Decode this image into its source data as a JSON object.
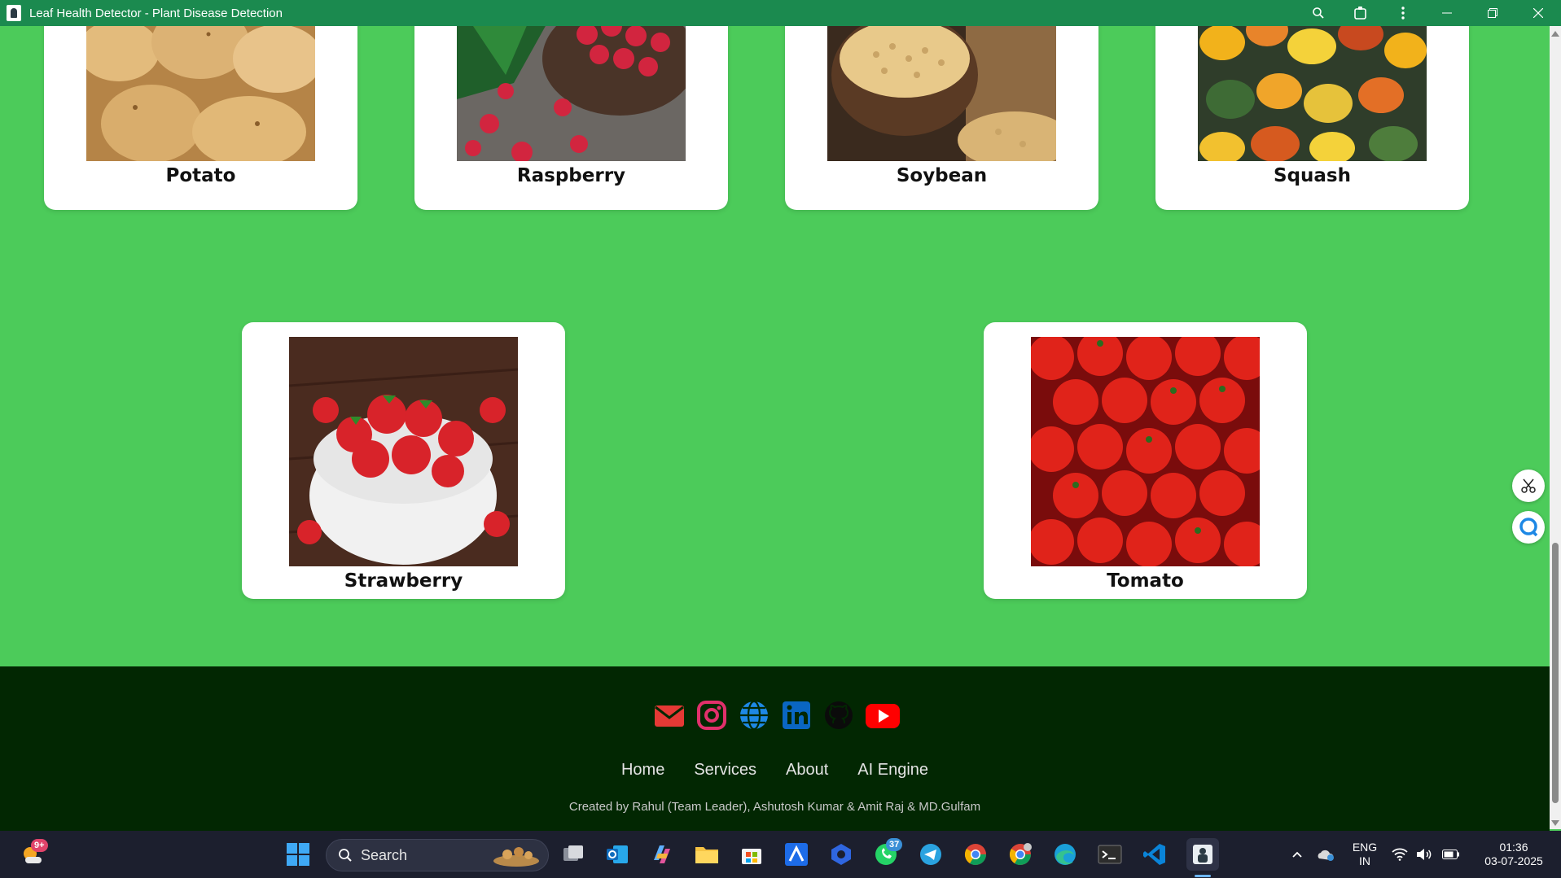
{
  "window": {
    "title": "Leaf Health Detector - Plant Disease Detection"
  },
  "cards": [
    {
      "label": "Potato"
    },
    {
      "label": "Raspberry"
    },
    {
      "label": "Soybean"
    },
    {
      "label": "Squash"
    },
    {
      "label": "Strawberry"
    },
    {
      "label": "Tomato"
    }
  ],
  "footer": {
    "social_icons": [
      "mail-icon",
      "instagram-icon",
      "globe-icon",
      "linkedin-icon",
      "github-icon",
      "youtube-icon"
    ],
    "nav": [
      "Home",
      "Services",
      "About",
      "AI Engine"
    ],
    "credits": "Created by Rahul (Team Leader), Ashutosh Kumar & Amit Raj & MD.Gulfam"
  },
  "taskbar": {
    "search_label": "Search",
    "weather_badge": "9+",
    "whatsapp_badge": "37",
    "language_top": "ENG",
    "language_bottom": "IN",
    "time": "01:36",
    "date": "03-07-2025"
  },
  "colors": {
    "page_bg": "#4ccb5a",
    "footer_bg": "#022702",
    "titlebar_bg": "#1b8a4f"
  }
}
